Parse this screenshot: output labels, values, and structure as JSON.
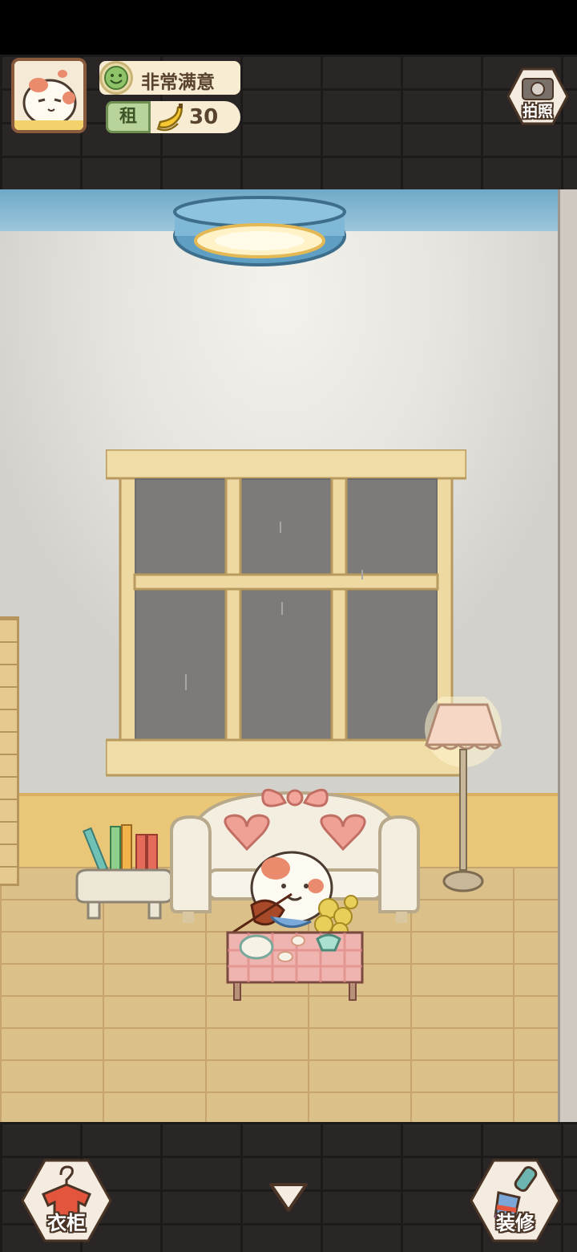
{
  "hud": {
    "satisfaction": {
      "icon": "smiley-face-icon",
      "label": "非常满意"
    },
    "rent": {
      "tag": "租",
      "icon": "banana-icon",
      "value": "30"
    },
    "photo_button": {
      "icon": "camera-icon",
      "label": "拍照"
    }
  },
  "bottom_bar": {
    "wardrobe_button": {
      "icon": "hanger-shirt-icon",
      "label": "衣柜"
    },
    "collapse_button": {
      "icon": "chevron-down-icon"
    },
    "decorate_button": {
      "icon": "paint-brush-icon",
      "label": "装修"
    }
  },
  "colors": {
    "brick": "#2b2626",
    "wall": "#e6e4de",
    "floor": "#dcc08a",
    "wainscot": "#e9c777",
    "hud_pill": "#f8edd3",
    "text_dark": "#5a4230"
  }
}
